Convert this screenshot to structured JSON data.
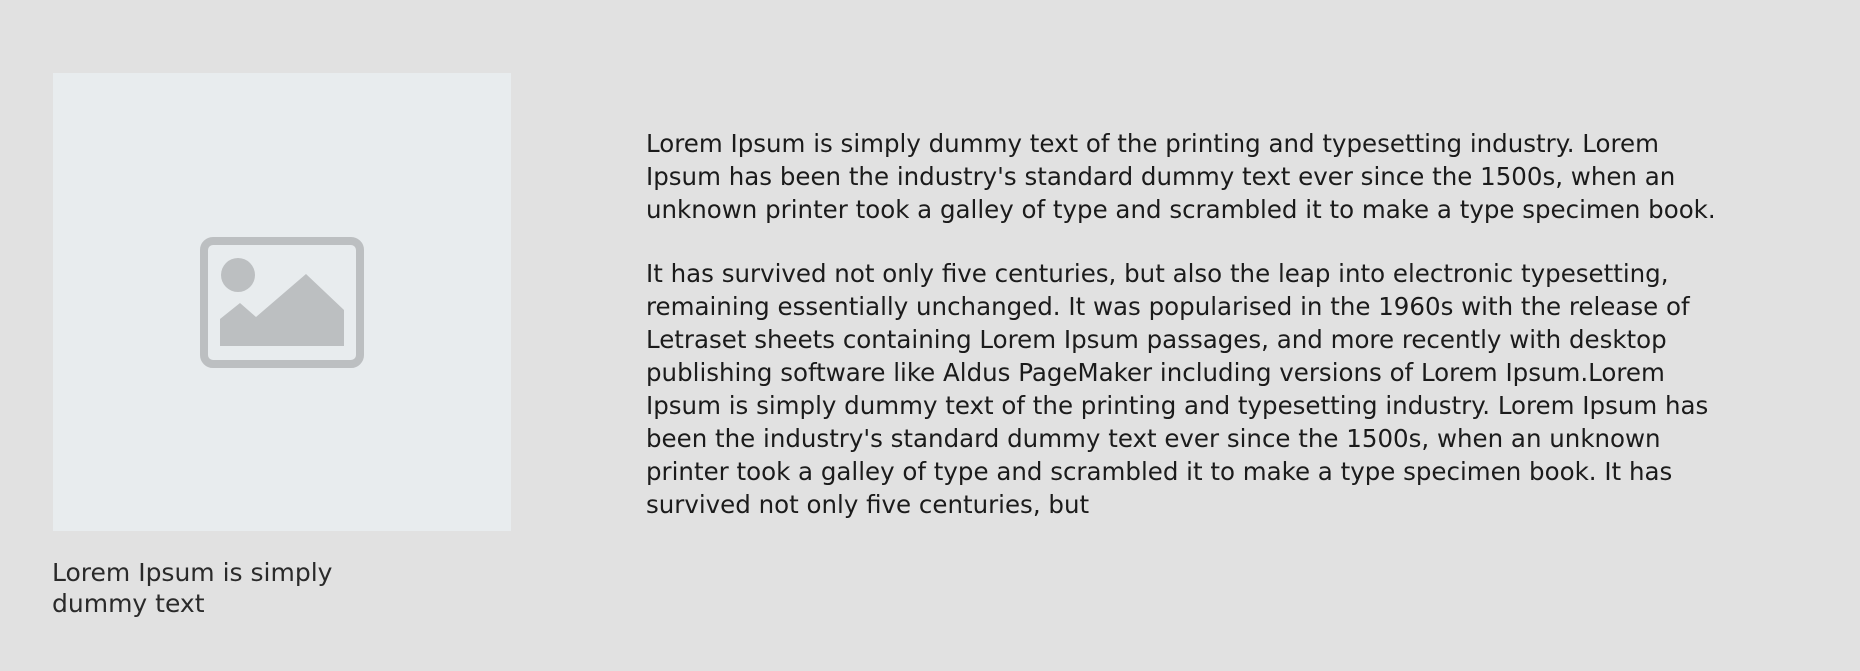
{
  "figure": {
    "icon": "image-placeholder-icon",
    "caption": "Lorem Ipsum is simply dummy text"
  },
  "article": {
    "paragraphs": [
      "Lorem Ipsum is simply dummy text of the printing and typesetting industry. Lorem Ipsum has been the industry's standard dummy text ever since the 1500s, when an unknown printer took a galley of type and scrambled it to make a type specimen book.",
      "It has survived not only five centuries, but also the leap into electronic typesetting, remaining essentially unchanged. It was popularised in the 1960s with the release of Letraset sheets containing Lorem Ipsum passages, and more recently with desktop publishing software like Aldus PageMaker including versions of Lorem Ipsum.Lorem Ipsum is simply dummy text of the printing and typesetting industry. Lorem Ipsum has been the industry's standard dummy text ever since the 1500s, when an unknown printer took a galley of type and scrambled it to make a type specimen book. It has survived not only five centuries, but"
    ]
  },
  "colors": {
    "page_background": "#e1e1e1",
    "placeholder_background": "#e8ecee",
    "placeholder_icon": "#bcbfc1"
  }
}
